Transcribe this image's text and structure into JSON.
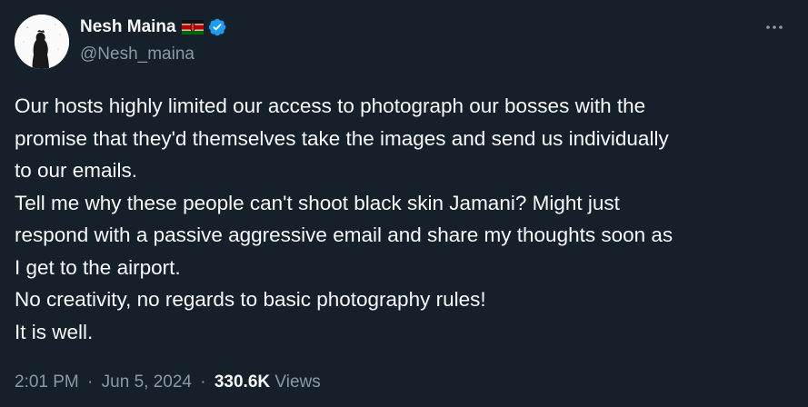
{
  "tweet": {
    "author": {
      "display_name": "Nesh Maina",
      "handle": "@Nesh_maina",
      "flag_icon": "kenya-flag-icon",
      "verified_icon": "verified-badge-icon",
      "verified_color": "#1d9bf0"
    },
    "menu_icon": "more-options-icon",
    "body_lines": [
      "Our hosts highly limited our access to photograph our bosses with the",
      "promise that they'd themselves take the images and send us individually",
      "to our emails.",
      "Tell me why these people can't shoot black skin Jamani? Might just",
      "respond with a passive aggressive email and share my thoughts soon as",
      "I get to the airport.",
      "No creativity, no regards to basic photography rules!",
      "It is well."
    ],
    "meta": {
      "time": "2:01 PM",
      "separator": "·",
      "date": "Jun 5, 2024",
      "views_count": "330.6K",
      "views_label": "Views"
    }
  },
  "colors": {
    "background": "#15202b",
    "primary_text": "#f7f9f9",
    "secondary_text": "#8b98a5"
  }
}
